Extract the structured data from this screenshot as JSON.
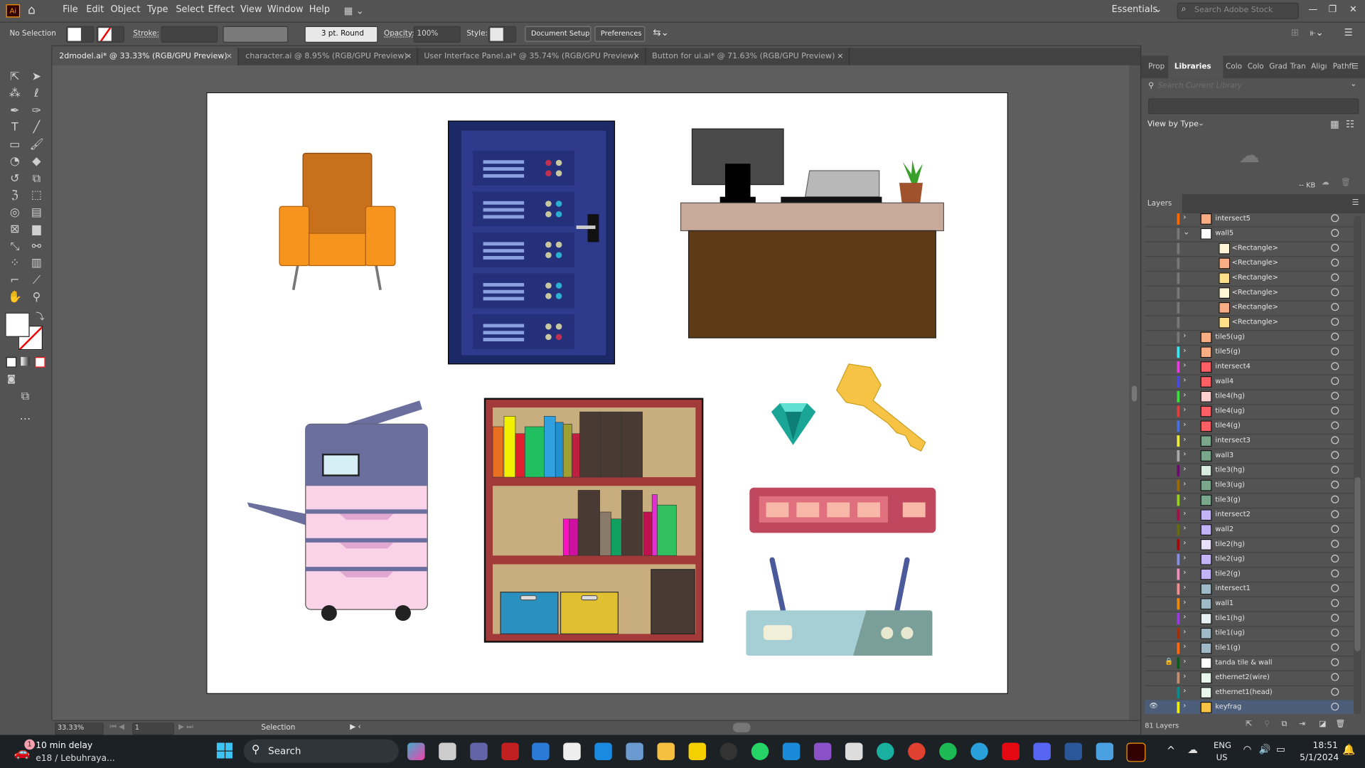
{
  "app": {
    "logo": "Ai",
    "menu": [
      "File",
      "Edit",
      "Object",
      "Type",
      "Select",
      "Effect",
      "View",
      "Window",
      "Help"
    ],
    "workspace": "Essentials",
    "stock_search_placeholder": "Search Adobe Stock"
  },
  "control_bar": {
    "selection": "No Selection",
    "stroke_label": "Stroke:",
    "brush": "3 pt. Round",
    "opacity_label": "Opacity:",
    "opacity_value": "100%",
    "style_label": "Style:",
    "document_setup": "Document Setup",
    "preferences": "Preferences"
  },
  "tabs": [
    {
      "label": "2dmodel.ai* @ 33.33% (RGB/GPU Preview)",
      "active": true
    },
    {
      "label": "character.ai @ 8.95% (RGB/GPU Preview)"
    },
    {
      "label": "User Interface Panel.ai* @ 35.74% (RGB/GPU Preview)"
    },
    {
      "label": "Button for ui.ai* @ 71.63% (RGB/GPU Preview)"
    }
  ],
  "status_bar": {
    "zoom": "33.33%",
    "artboard": "1",
    "tool": "Selection"
  },
  "right_panel": {
    "tabs": [
      "Prop",
      "Libraries",
      "Colo",
      "Colo",
      "Grad",
      "Tran",
      "Aligı",
      "Pathfi"
    ],
    "active_tab": "Libraries",
    "library_search_placeholder": "Search Current Library",
    "view_by": "View by Type",
    "storage": "-- KB",
    "layers_tab": "Layers",
    "layer_count": "81 Layers",
    "layers": [
      {
        "name": "intersect5",
        "strip": "#ff6a00",
        "thumb": "#f9ad85"
      },
      {
        "name": "wall5",
        "strip": "#777777",
        "thumb": "#ffffff",
        "expanded": true
      },
      {
        "name": "<Rectangle>",
        "strip": "#777777",
        "thumb": "#fff6d8",
        "child": true
      },
      {
        "name": "<Rectangle>",
        "strip": "#777777",
        "thumb": "#f9ad85",
        "child": true
      },
      {
        "name": "<Rectangle>",
        "strip": "#777777",
        "thumb": "#ffe08a",
        "child": true
      },
      {
        "name": "<Rectangle>",
        "strip": "#777777",
        "thumb": "#fff6d8",
        "child": true
      },
      {
        "name": "<Rectangle>",
        "strip": "#777777",
        "thumb": "#f9ad85",
        "child": true
      },
      {
        "name": "<Rectangle>",
        "strip": "#777777",
        "thumb": "#ffe08a",
        "child": true
      },
      {
        "name": "tile5(ug)",
        "strip": "#777777",
        "thumb": "#f9ad85"
      },
      {
        "name": "tile5(g)",
        "strip": "#3ee6f0",
        "thumb": "#f9ad85"
      },
      {
        "name": "intersect4",
        "strip": "#e83ee0",
        "thumb": "#ff6066"
      },
      {
        "name": "wall4",
        "strip": "#4a4ae0",
        "thumb": "#ff6066"
      },
      {
        "name": "tile4(hg)",
        "strip": "#3ee03e",
        "thumb": "#ffd0d0"
      },
      {
        "name": "tile4(ug)",
        "strip": "#e04040",
        "thumb": "#ff6066"
      },
      {
        "name": "tile4(g)",
        "strip": "#4a70e0",
        "thumb": "#ff6066"
      },
      {
        "name": "intersect3",
        "strip": "#f0f040",
        "thumb": "#7aa68c"
      },
      {
        "name": "wall3",
        "strip": "#aaaaaa",
        "thumb": "#7aa68c"
      },
      {
        "name": "tile3(hg)",
        "strip": "#6a0a6a",
        "thumb": "#d9ece2"
      },
      {
        "name": "tile3(ug)",
        "strip": "#9a6a0a",
        "thumb": "#7aa68c"
      },
      {
        "name": "tile3(g)",
        "strip": "#9ad020",
        "thumb": "#7aa68c"
      },
      {
        "name": "intersect2",
        "strip": "#a0104a",
        "thumb": "#c3b4f8"
      },
      {
        "name": "wall2",
        "strip": "#6a6a10",
        "thumb": "#c3b4f8"
      },
      {
        "name": "tile2(hg)",
        "strip": "#a00a0a",
        "thumb": "#e6e0fb"
      },
      {
        "name": "tile2(ug)",
        "strip": "#8a90e0",
        "thumb": "#c3b4f8"
      },
      {
        "name": "tile2(g)",
        "strip": "#f090c0",
        "thumb": "#c3b4f8"
      },
      {
        "name": "intersect1",
        "strip": "#f09090",
        "thumb": "#9fb9c6"
      },
      {
        "name": "wall1",
        "strip": "#f08a0a",
        "thumb": "#9fb9c6"
      },
      {
        "name": "tile1(hg)",
        "strip": "#9a3ae0",
        "thumb": "#e6f0f2"
      },
      {
        "name": "tile1(ug)",
        "strip": "#a0300a",
        "thumb": "#9fb9c6"
      },
      {
        "name": "tile1(g)",
        "strip": "#ff6a10",
        "thumb": "#9fb9c6"
      },
      {
        "name": "tanda tile & wall",
        "strip": "#0a5a1a",
        "thumb": "#ffffff",
        "locked": true
      },
      {
        "name": "ethernet2(wire)",
        "strip": "#c09070",
        "thumb": "#e8f7ee"
      },
      {
        "name": "ethernet1(head)",
        "strip": "#0a8a8a",
        "thumb": "#e8f7ee"
      },
      {
        "name": "keyfrag",
        "strip": "#f0f010",
        "thumb": "#f6c344",
        "selected": true,
        "visible": true
      }
    ]
  },
  "taskbar": {
    "weather_title": "10 min delay",
    "weather_sub": "e18 / Lebuhraya...",
    "badge": "1",
    "search": "Search",
    "lang1": "ENG",
    "lang2": "US",
    "time": "18:51",
    "date": "5/1/2024"
  }
}
